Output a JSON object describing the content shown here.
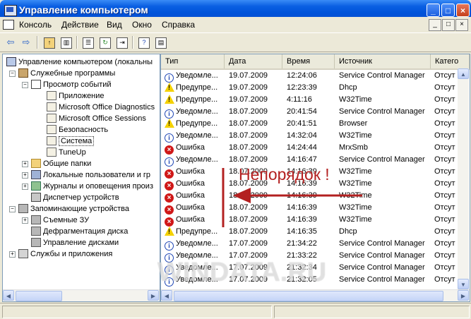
{
  "window": {
    "title": "Управление компьютером",
    "minimize": "_",
    "maximize": "□",
    "close": "×"
  },
  "menu": [
    "Консоль",
    "Действие",
    "Вид",
    "Окно",
    "Справка"
  ],
  "mdi_buttons": [
    "_",
    "□",
    "×"
  ],
  "toolbar_icons": [
    "back-arrow-icon",
    "forward-arrow-icon",
    "up-folder-icon",
    "show-hide-tree-icon",
    "properties-icon",
    "refresh-icon",
    "export-list-icon",
    "help-icon",
    "help-topics-icon"
  ],
  "tree": {
    "root": "Управление компьютером (локальны",
    "service": "Служебные программы",
    "event_viewer": "Просмотр событий",
    "app": "Приложение",
    "mso_diag": "Microsoft Office Diagnostics",
    "mso_sess": "Microsoft Office Sessions",
    "security": "Безопасность",
    "system": "Система",
    "tuneup": "TuneUp",
    "shared": "Общие папки",
    "users": "Локальные пользователи и гр",
    "perf": "Журналы и оповещения произ",
    "devmgr": "Диспетчер устройств",
    "storage": "Запоминающие устройства",
    "removable": "Съемные ЗУ",
    "defrag": "Дефрагментация диска",
    "diskmgmt": "Управление дисками",
    "services": "Службы и приложения"
  },
  "columns": [
    "Тип",
    "Дата",
    "Время",
    "Источник",
    "Катего"
  ],
  "rows": [
    {
      "type": "info",
      "label": "Уведомле...",
      "date": "19.07.2009",
      "time": "12:24:06",
      "source": "Service Control Manager",
      "cat": "Отсут"
    },
    {
      "type": "warn",
      "label": "Предупре...",
      "date": "19.07.2009",
      "time": "12:23:39",
      "source": "Dhcp",
      "cat": "Отсут"
    },
    {
      "type": "warn",
      "label": "Предупре...",
      "date": "19.07.2009",
      "time": "4:11:16",
      "source": "W32Time",
      "cat": "Отсут"
    },
    {
      "type": "info",
      "label": "Уведомле...",
      "date": "18.07.2009",
      "time": "20:41:54",
      "source": "Service Control Manager",
      "cat": "Отсут"
    },
    {
      "type": "warn",
      "label": "Предупре...",
      "date": "18.07.2009",
      "time": "20:41:51",
      "source": "Browser",
      "cat": "Отсут"
    },
    {
      "type": "info",
      "label": "Уведомле...",
      "date": "18.07.2009",
      "time": "14:32:04",
      "source": "W32Time",
      "cat": "Отсут"
    },
    {
      "type": "err",
      "label": "Ошибка",
      "date": "18.07.2009",
      "time": "14:24:44",
      "source": "MrxSmb",
      "cat": "Отсут"
    },
    {
      "type": "info",
      "label": "Уведомле...",
      "date": "18.07.2009",
      "time": "14:16:47",
      "source": "Service Control Manager",
      "cat": "Отсут"
    },
    {
      "type": "err",
      "label": "Ошибка",
      "date": "18.07.2009",
      "time": "14:16:39",
      "source": "W32Time",
      "cat": "Отсут"
    },
    {
      "type": "err",
      "label": "Ошибка",
      "date": "18.07.2009",
      "time": "14:16:39",
      "source": "W32Time",
      "cat": "Отсут"
    },
    {
      "type": "err",
      "label": "Ошибка",
      "date": "18.07.2009",
      "time": "14:16:39",
      "source": "W32Time",
      "cat": "Отсут"
    },
    {
      "type": "err",
      "label": "Ошибка",
      "date": "18.07.2009",
      "time": "14:16:39",
      "source": "W32Time",
      "cat": "Отсут"
    },
    {
      "type": "err",
      "label": "Ошибка",
      "date": "18.07.2009",
      "time": "14:16:39",
      "source": "W32Time",
      "cat": "Отсут"
    },
    {
      "type": "warn",
      "label": "Предупре...",
      "date": "18.07.2009",
      "time": "14:16:35",
      "source": "Dhcp",
      "cat": "Отсут"
    },
    {
      "type": "info",
      "label": "Уведомле...",
      "date": "17.07.2009",
      "time": "21:34:22",
      "source": "Service Control Manager",
      "cat": "Отсут"
    },
    {
      "type": "info",
      "label": "Уведомле...",
      "date": "17.07.2009",
      "time": "21:33:22",
      "source": "Service Control Manager",
      "cat": "Отсут"
    },
    {
      "type": "info",
      "label": "Уведомле...",
      "date": "17.07.2009",
      "time": "21:32:34",
      "source": "Service Control Manager",
      "cat": "Отсут"
    },
    {
      "type": "info",
      "label": "Уведомле...",
      "date": "17.07.2009",
      "time": "21:32:05",
      "source": "Service Control Manager",
      "cat": "Отсут"
    }
  ],
  "annotation": "Непорядок !",
  "watermark": "WINDATA.RU",
  "colors": {
    "annotation": "#b32020",
    "titlebar": "#0a5fe2",
    "error": "#d01818",
    "warning": "#f4d100",
    "info": "#1f47b5"
  }
}
